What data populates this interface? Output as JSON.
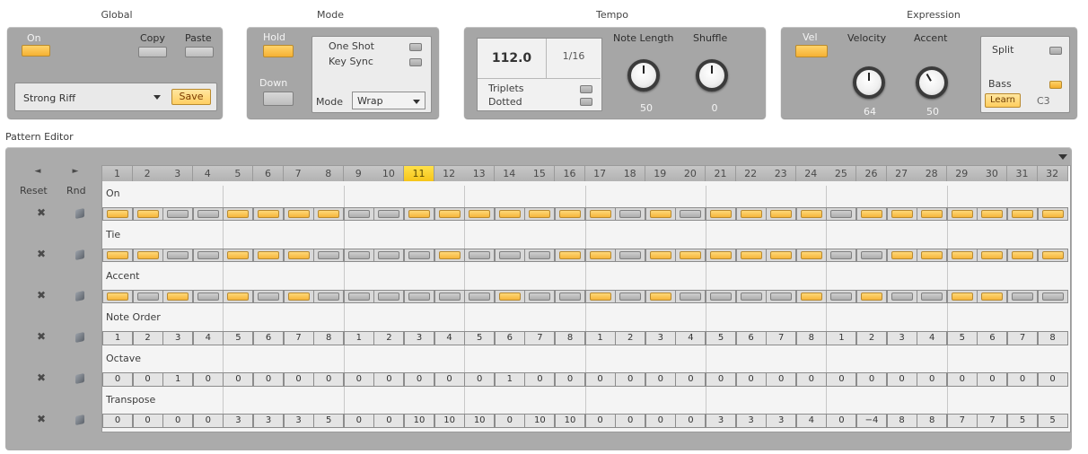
{
  "sections": {
    "global": "Global",
    "mode": "Mode",
    "tempo": "Tempo",
    "expression": "Expression"
  },
  "global": {
    "on_label": "On",
    "copy_label": "Copy",
    "paste_label": "Paste",
    "preset": "Strong Riff",
    "save_label": "Save"
  },
  "mode": {
    "hold_label": "Hold",
    "down_label": "Down",
    "one_shot_label": "One Shot",
    "key_sync_label": "Key Sync",
    "mode_label": "Mode",
    "mode_value": "Wrap"
  },
  "tempo": {
    "bpm": "112.0",
    "rate": "1/16",
    "triplets_label": "Triplets",
    "dotted_label": "Dotted",
    "note_length_label": "Note Length",
    "shuffle_label": "Shuffle",
    "note_length_value": "50",
    "shuffle_value": "0"
  },
  "expression": {
    "vel_label": "Vel",
    "velocity_label": "Velocity",
    "accent_label": "Accent",
    "velocity_value": "64",
    "accent_value": "50",
    "split_label": "Split",
    "bass_label": "Bass",
    "learn_label": "Learn",
    "learn_note": "C3"
  },
  "pattern_editor": {
    "title": "Pattern Editor",
    "reset_label": "Reset",
    "rnd_label": "Rnd",
    "prev_icon": "◄",
    "next_icon": "►",
    "current_step": 11,
    "steps": [
      "1",
      "2",
      "3",
      "4",
      "5",
      "6",
      "7",
      "8",
      "9",
      "10",
      "11",
      "12",
      "13",
      "14",
      "15",
      "16",
      "17",
      "18",
      "19",
      "20",
      "21",
      "22",
      "23",
      "24",
      "25",
      "26",
      "27",
      "28",
      "29",
      "30",
      "31",
      "32"
    ],
    "rows": [
      {
        "key": "on",
        "label": "On",
        "type": "toggle",
        "values": [
          1,
          1,
          0,
          0,
          1,
          1,
          1,
          1,
          0,
          0,
          1,
          1,
          1,
          1,
          1,
          1,
          1,
          0,
          1,
          0,
          1,
          1,
          1,
          1,
          0,
          1,
          1,
          1,
          1,
          1,
          1,
          1
        ]
      },
      {
        "key": "tie",
        "label": "Tie",
        "type": "toggle",
        "values": [
          1,
          1,
          0,
          0,
          1,
          1,
          1,
          0,
          0,
          0,
          0,
          1,
          0,
          0,
          0,
          1,
          1,
          0,
          1,
          1,
          1,
          1,
          1,
          1,
          0,
          0,
          1,
          1,
          1,
          1,
          1,
          1
        ]
      },
      {
        "key": "accent",
        "label": "Accent",
        "type": "toggle",
        "values": [
          1,
          0,
          1,
          0,
          1,
          0,
          1,
          0,
          0,
          0,
          0,
          0,
          0,
          1,
          0,
          0,
          1,
          0,
          1,
          0,
          0,
          0,
          0,
          1,
          0,
          1,
          0,
          0,
          1,
          1,
          0,
          0
        ]
      },
      {
        "key": "note_order",
        "label": "Note Order",
        "type": "number",
        "values": [
          "1",
          "2",
          "3",
          "4",
          "5",
          "6",
          "7",
          "8",
          "1",
          "2",
          "3",
          "4",
          "5",
          "6",
          "7",
          "8",
          "1",
          "2",
          "3",
          "4",
          "5",
          "6",
          "7",
          "8",
          "1",
          "2",
          "3",
          "4",
          "5",
          "6",
          "7",
          "8"
        ]
      },
      {
        "key": "octave",
        "label": "Octave",
        "type": "number",
        "values": [
          "0",
          "0",
          "1",
          "0",
          "0",
          "0",
          "0",
          "0",
          "0",
          "0",
          "0",
          "0",
          "0",
          "1",
          "0",
          "0",
          "0",
          "0",
          "0",
          "0",
          "0",
          "0",
          "0",
          "0",
          "0",
          "0",
          "0",
          "0",
          "0",
          "0",
          "0",
          "0"
        ]
      },
      {
        "key": "transpose",
        "label": "Transpose",
        "type": "number",
        "values": [
          "0",
          "0",
          "0",
          "0",
          "3",
          "3",
          "3",
          "5",
          "0",
          "0",
          "10",
          "10",
          "10",
          "0",
          "10",
          "10",
          "0",
          "0",
          "0",
          "0",
          "3",
          "3",
          "3",
          "4",
          "0",
          "−4",
          "8",
          "8",
          "7",
          "7",
          "5",
          "5"
        ]
      }
    ]
  }
}
